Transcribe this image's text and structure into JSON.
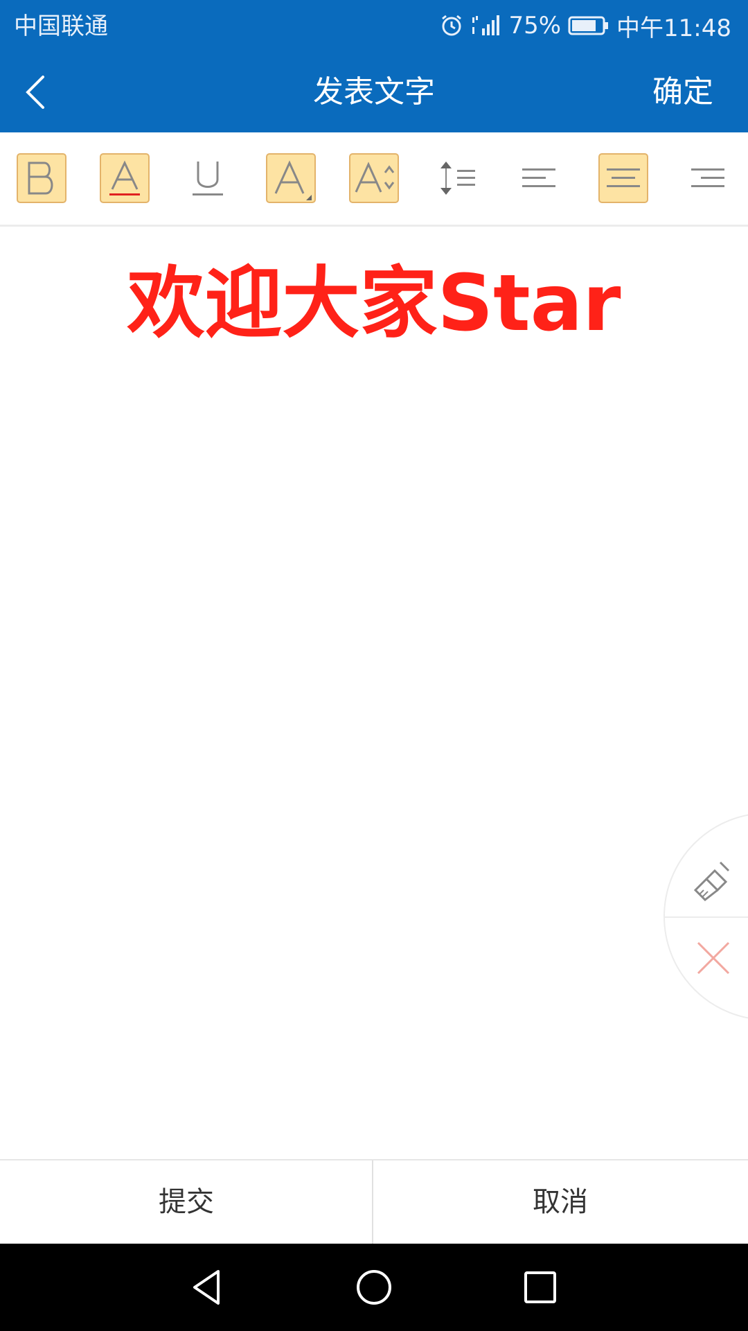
{
  "status_bar": {
    "carrier": "中国联通",
    "battery_percent": "75%",
    "time": "中午11:48",
    "icons": [
      "alarm-icon",
      "signal-icon",
      "battery-icon"
    ]
  },
  "title_bar": {
    "back_icon": "chevron-left-icon",
    "title": "发表文字",
    "confirm_label": "确定"
  },
  "toolbar": {
    "tools": [
      {
        "name": "bold",
        "icon": "bold-icon",
        "active": true
      },
      {
        "name": "font-color",
        "icon": "font-color-icon",
        "active": true
      },
      {
        "name": "underline",
        "icon": "underline-icon",
        "active": false
      },
      {
        "name": "font-size",
        "icon": "font-size-icon",
        "active": true
      },
      {
        "name": "font-size-adjust",
        "icon": "font-size-adjust-icon",
        "active": true
      },
      {
        "name": "line-spacing",
        "icon": "line-spacing-icon",
        "active": false
      },
      {
        "name": "align-left",
        "icon": "align-left-icon",
        "active": false
      },
      {
        "name": "align-center",
        "icon": "align-center-icon",
        "active": true
      },
      {
        "name": "align-right",
        "icon": "align-right-icon",
        "active": false
      }
    ]
  },
  "editor": {
    "content": "欢迎大家Star",
    "text_color": "#ff2218"
  },
  "float_menu": {
    "icons": [
      "broom-icon",
      "close-icon"
    ]
  },
  "actions": {
    "submit_label": "提交",
    "cancel_label": "取消"
  },
  "colors": {
    "header": "#0a6bbd",
    "active_tool": "#fde3a3",
    "accent_red": "#ff2218"
  }
}
